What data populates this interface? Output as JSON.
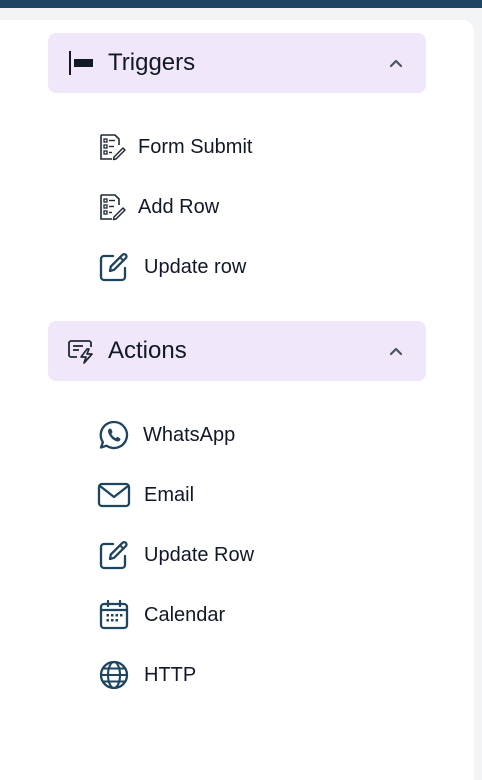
{
  "sections": {
    "triggers": {
      "title": "Triggers",
      "expanded": true,
      "items": [
        {
          "label": "Form Submit",
          "icon": "form-list-icon"
        },
        {
          "label": "Add Row",
          "icon": "form-list-icon"
        },
        {
          "label": "Update row",
          "icon": "edit-icon"
        }
      ]
    },
    "actions": {
      "title": "Actions",
      "expanded": true,
      "items": [
        {
          "label": "WhatsApp",
          "icon": "whatsapp-icon"
        },
        {
          "label": "Email",
          "icon": "mail-icon"
        },
        {
          "label": "Update Row",
          "icon": "edit-icon"
        },
        {
          "label": "Calendar",
          "icon": "calendar-icon"
        },
        {
          "label": "HTTP",
          "icon": "globe-icon"
        }
      ]
    }
  },
  "colors": {
    "header_bg": "#f0e7fb",
    "icon": "#1d4560",
    "topbar": "#1d4560",
    "text": "#111827"
  }
}
